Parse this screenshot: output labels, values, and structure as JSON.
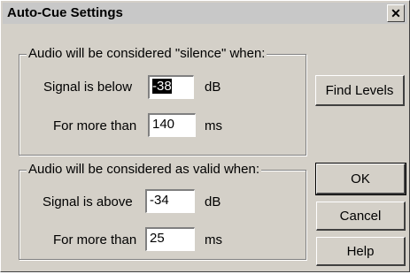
{
  "window": {
    "title": "Auto-Cue Settings",
    "close_glyph": "✕"
  },
  "silence_group": {
    "legend": "Audio will be considered \"silence\" when:",
    "signal_label": "Signal is below",
    "signal_value": "-38",
    "signal_unit": "dB",
    "duration_label": "For more than",
    "duration_value": "140",
    "duration_unit": "ms"
  },
  "valid_group": {
    "legend": "Audio will be considered as valid when:",
    "signal_label": "Signal is above",
    "signal_value": "-34",
    "signal_unit": "dB",
    "duration_label": "For more than",
    "duration_value": "25",
    "duration_unit": "ms"
  },
  "buttons": {
    "find_levels": "Find Levels",
    "ok": "OK",
    "cancel": "Cancel",
    "help": "Help"
  }
}
